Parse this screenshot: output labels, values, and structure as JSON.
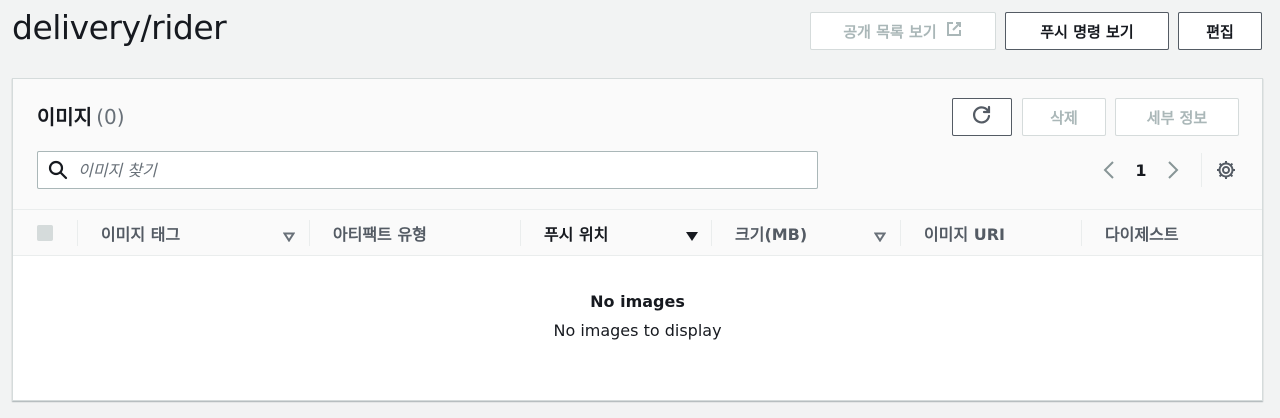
{
  "header": {
    "title": "delivery/rider",
    "public_view_label": "공개 목록 보기",
    "push_commands_label": "푸시 명령 보기",
    "edit_label": "편집"
  },
  "images_panel": {
    "title": "이미지",
    "count": "(0)",
    "delete_label": "삭제",
    "details_label": "세부 정보",
    "search_placeholder": "이미지 찾기",
    "page_number": "1",
    "columns": [
      "이미지 태그",
      "아티팩트 유형",
      "푸시 위치",
      "크기(MB)",
      "이미지 URI",
      "다이제스트"
    ],
    "empty_title": "No images",
    "empty_description": "No images to display"
  },
  "colors": {
    "background": "#f2f3f3",
    "border_dark": "#545b64",
    "disabled_text": "#aab7b8"
  }
}
